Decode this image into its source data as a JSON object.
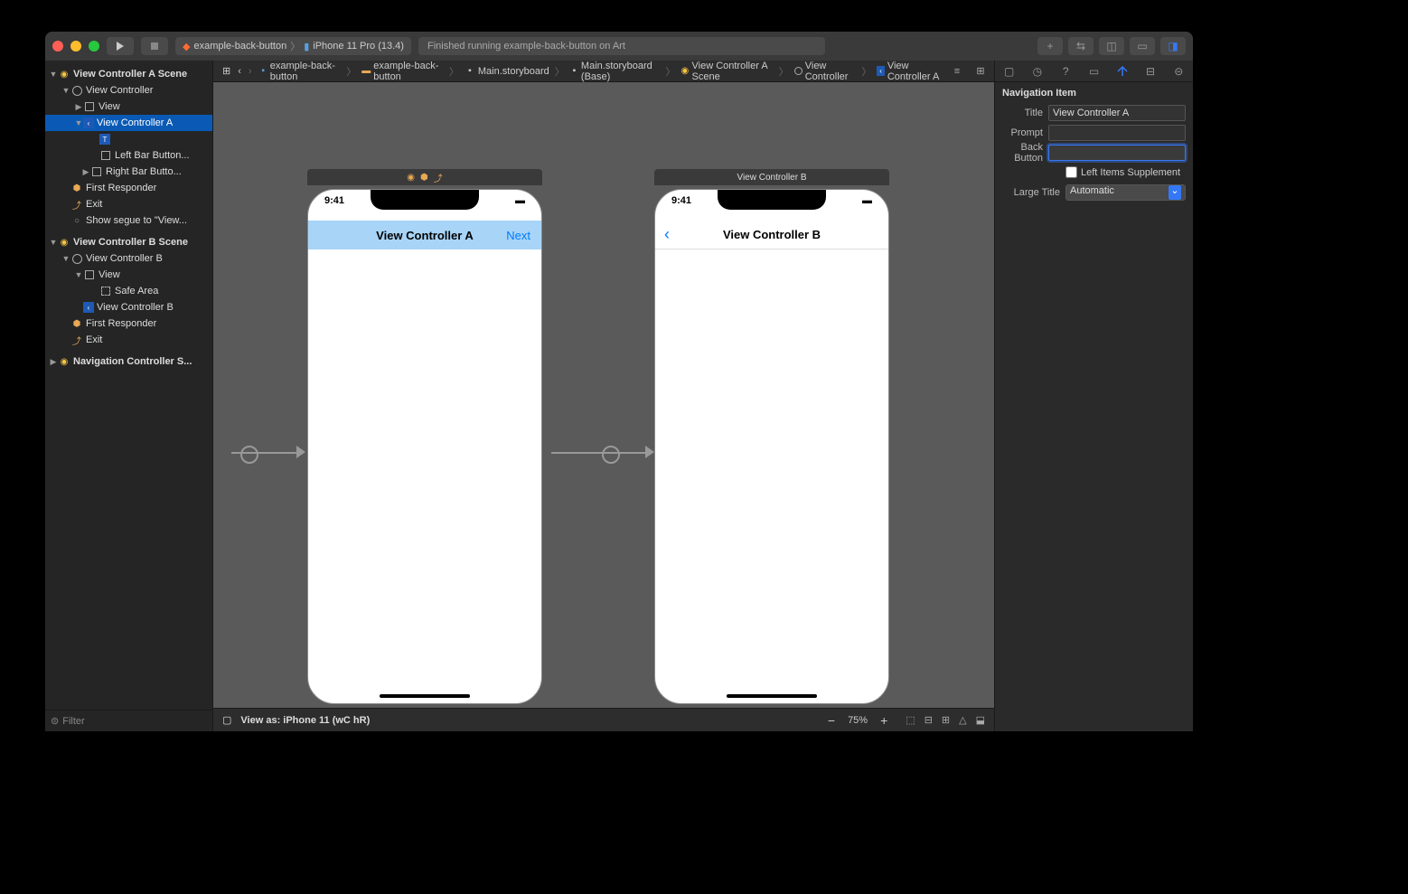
{
  "titlebar": {
    "scheme_project": "example-back-button",
    "scheme_device": "iPhone 11 Pro (13.4)",
    "status": "Finished running example-back-button on Art"
  },
  "jumpbar": {
    "grid_icon": "⊞",
    "back": "‹",
    "forward": "›"
  },
  "breadcrumb": {
    "project": "example-back-button",
    "folder": "example-back-button",
    "storyboard": "Main.storyboard",
    "storyboard_base": "Main.storyboard (Base)",
    "scene": "View Controller A Scene",
    "vc": "View Controller",
    "navitem": "View Controller A"
  },
  "outline": {
    "sceneA": {
      "title": "View Controller A Scene",
      "vc": "View Controller",
      "view": "View",
      "navitem": "View Controller A",
      "titleItem": "T",
      "leftBar": "Left Bar Button...",
      "rightBar": "Right Bar Butto...",
      "firstResponder": "First Responder",
      "exit": "Exit",
      "segue": "Show segue to \"View..."
    },
    "sceneB": {
      "title": "View Controller B Scene",
      "vc": "View Controller B",
      "view": "View",
      "safeArea": "Safe Area",
      "navitem": "View Controller B",
      "firstResponder": "First Responder",
      "exit": "Exit"
    },
    "navScene": "Navigation Controller S..."
  },
  "filter_placeholder": "Filter",
  "canvas": {
    "phoneA": {
      "time": "9:41",
      "title": "View Controller A",
      "next": "Next"
    },
    "phoneB": {
      "time": "9:41",
      "headerLabel": "View Controller B",
      "title": "View Controller B"
    }
  },
  "bottomBar": {
    "viewAs": "View as: iPhone 11 (wC hR)",
    "zoom": "75%"
  },
  "inspector": {
    "section": "Navigation Item",
    "titleLabel": "Title",
    "titleValue": "View Controller A",
    "promptLabel": "Prompt",
    "promptValue": "",
    "backButtonLabel": "Back Button",
    "backButtonValue": "",
    "leftItemsLabel": "Left Items Supplement",
    "largeTitleLabel": "Large Title",
    "largeTitleValue": "Automatic"
  }
}
